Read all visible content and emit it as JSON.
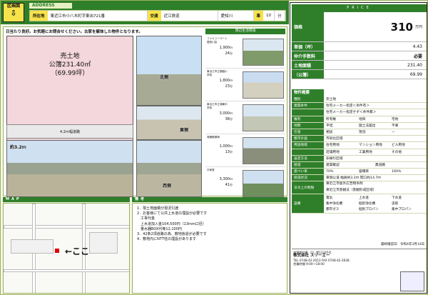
{
  "header": {
    "kukaku_label": "区画図",
    "address_label": "ADDRESS",
    "fields": [
      {
        "k": "所在地",
        "v": "東近江市小八木町字東出721番"
      },
      {
        "k": "交通",
        "v": "近江鉄道"
      },
      {
        "k": "",
        "v": "愛知川"
      },
      {
        "k": "車",
        "v": "10"
      },
      {
        "k": "",
        "v": "分"
      }
    ]
  },
  "left": {
    "note": "日当たり良好。お気軽にお問合せください。古家を解体した物件となります。",
    "plan": {
      "line1": "売土地",
      "line2": "公簿231.40㎡",
      "line3": "（69.99坪）",
      "small": "※掲載区画はあくまでも現況を参考に図示しており、実際とは異なる場合があります。"
    },
    "road_label": "4.2ｍ幅道路",
    "captions": {
      "b": "北側",
      "c": "東側",
      "d": "西側",
      "a": "約3.2ｍ"
    }
  },
  "facilities": {
    "title": "周辺生活環境",
    "items": [
      {
        "name": "ファミリーマート愛知川店",
        "dist": "1,900",
        "unit": "ｍ",
        "min": "24",
        "unit2": "分"
      },
      {
        "name": "東近江市立御園小学校",
        "dist": "1,800",
        "unit": "ｍ",
        "min": "23",
        "unit2": "分"
      },
      {
        "name": "東近江市立湖東中学校",
        "dist": "3,000",
        "unit": "ｍ",
        "min": "38",
        "unit2": "分"
      },
      {
        "name": "湖東郵便局",
        "dist": "1,000",
        "unit": "ｍ",
        "min": "13",
        "unit2": "分"
      },
      {
        "name": "平和堂",
        "dist": "3,300",
        "unit": "ｍ",
        "min": "41",
        "unit2": "分"
      }
    ]
  },
  "map": {
    "title": "MAP",
    "here": "←ここ"
  },
  "remarks": {
    "title": "備考",
    "lines": [
      "1．現土地面積分現況引渡",
      "2．お客様にて公共上水道の埋設が必要です",
      "　工事代金",
      "　上水道加入金104,500円（13mm口径）",
      "　量水器BOX代等12,100円",
      "3．42条2項道路の為、敷地後退が必要です",
      "4．敷地内にNTT柱の埋設があります"
    ]
  },
  "price": {
    "title": "PRICE",
    "rows": [
      {
        "k": "価格",
        "v": "310",
        "unit": "万円"
      },
      {
        "k": "単価（坪）",
        "v": "4.43"
      },
      {
        "k": "仲介手数料",
        "v": "必要"
      },
      {
        "k": "土地面積",
        "v": "231.40"
      },
      {
        "k": "（公簿）",
        "v": "69.99"
      }
    ]
  },
  "detail": {
    "title": "物件概要",
    "rows": [
      {
        "k": "種別",
        "v": [
          "売土地"
        ]
      },
      {
        "k": "建築条件",
        "v": [
          "住宅メーカー指定＜条件有＞"
        ]
      },
      {
        "k": "",
        "v": [
          "住宅メーカー指定せず＜条件無＞"
        ]
      },
      {
        "k": "権利",
        "v": [
          "所有権",
          "地目",
          "宅地"
        ]
      },
      {
        "k": "地勢",
        "v": [
          "平坦",
          "国土法届出",
          "不要"
        ]
      },
      {
        "k": "引渡",
        "v": [
          "相談",
          "現況",
          "—"
        ]
      },
      {
        "k": "都市計画",
        "v": [
          "市街化区域",
          "",
          ""
        ]
      },
      {
        "k": "用途地域",
        "v": [
          "住宅用地",
          "マンション用地",
          "ビル用地"
        ]
      },
      {
        "k": "",
        "v": [
          "店舗用地",
          "工業用地",
          "その他"
        ]
      },
      {
        "k": "設定方法",
        "v": [
          "非線引区域"
        ]
      },
      {
        "k": "接道",
        "v": [
          "建築確認",
          "無道路"
        ]
      },
      {
        "k": "建ぺい率",
        "v": [
          "70%",
          "容積率",
          "160%"
        ]
      },
      {
        "k": "接道状況",
        "v": [
          "東側公道 幅員約3.2ｍ 間口約14.7ｍ"
        ]
      },
      {
        "k": "法令上の制限",
        "v": [
          "東近江市屋外広告物条例",
          "東近江市景観法（景観形成区域）"
        ]
      }
    ],
    "utilities": [
      "電気",
      "上水道",
      "下水道",
      "集中浄化槽",
      "個別浄化槽",
      "汲取",
      "都市ガス",
      "個別プロパン",
      "集中プロパン"
    ]
  },
  "footer": {
    "lines": [
      "滋賀県知事（1）第12345号",
      "株式会社 スリーエー",
      "TEL 0748-42-2013 FAX 0748-42-2638",
      "営業時間 9:00〜18:00"
    ],
    "date": "最終確認日：令和4年3月14日"
  }
}
